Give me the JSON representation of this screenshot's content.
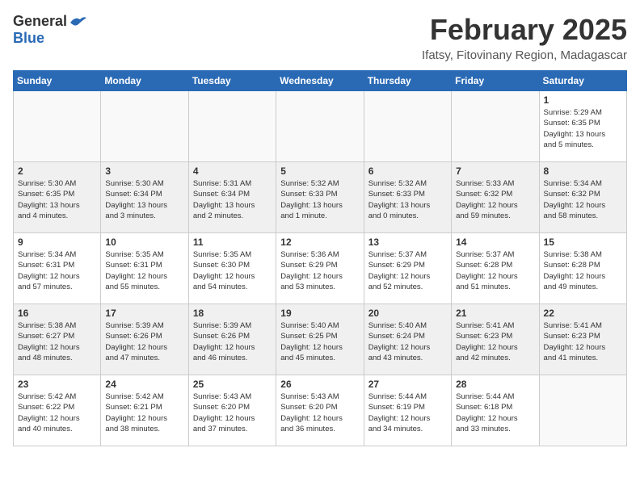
{
  "logo": {
    "general": "General",
    "blue": "Blue"
  },
  "title": "February 2025",
  "location": "Ifatsy, Fitovinany Region, Madagascar",
  "days_of_week": [
    "Sunday",
    "Monday",
    "Tuesday",
    "Wednesday",
    "Thursday",
    "Friday",
    "Saturday"
  ],
  "weeks": [
    [
      {
        "day": "",
        "info": ""
      },
      {
        "day": "",
        "info": ""
      },
      {
        "day": "",
        "info": ""
      },
      {
        "day": "",
        "info": ""
      },
      {
        "day": "",
        "info": ""
      },
      {
        "day": "",
        "info": ""
      },
      {
        "day": "1",
        "info": "Sunrise: 5:29 AM\nSunset: 6:35 PM\nDaylight: 13 hours\nand 5 minutes."
      }
    ],
    [
      {
        "day": "2",
        "info": "Sunrise: 5:30 AM\nSunset: 6:35 PM\nDaylight: 13 hours\nand 4 minutes."
      },
      {
        "day": "3",
        "info": "Sunrise: 5:30 AM\nSunset: 6:34 PM\nDaylight: 13 hours\nand 3 minutes."
      },
      {
        "day": "4",
        "info": "Sunrise: 5:31 AM\nSunset: 6:34 PM\nDaylight: 13 hours\nand 2 minutes."
      },
      {
        "day": "5",
        "info": "Sunrise: 5:32 AM\nSunset: 6:33 PM\nDaylight: 13 hours\nand 1 minute."
      },
      {
        "day": "6",
        "info": "Sunrise: 5:32 AM\nSunset: 6:33 PM\nDaylight: 13 hours\nand 0 minutes."
      },
      {
        "day": "7",
        "info": "Sunrise: 5:33 AM\nSunset: 6:32 PM\nDaylight: 12 hours\nand 59 minutes."
      },
      {
        "day": "8",
        "info": "Sunrise: 5:34 AM\nSunset: 6:32 PM\nDaylight: 12 hours\nand 58 minutes."
      }
    ],
    [
      {
        "day": "9",
        "info": "Sunrise: 5:34 AM\nSunset: 6:31 PM\nDaylight: 12 hours\nand 57 minutes."
      },
      {
        "day": "10",
        "info": "Sunrise: 5:35 AM\nSunset: 6:31 PM\nDaylight: 12 hours\nand 55 minutes."
      },
      {
        "day": "11",
        "info": "Sunrise: 5:35 AM\nSunset: 6:30 PM\nDaylight: 12 hours\nand 54 minutes."
      },
      {
        "day": "12",
        "info": "Sunrise: 5:36 AM\nSunset: 6:29 PM\nDaylight: 12 hours\nand 53 minutes."
      },
      {
        "day": "13",
        "info": "Sunrise: 5:37 AM\nSunset: 6:29 PM\nDaylight: 12 hours\nand 52 minutes."
      },
      {
        "day": "14",
        "info": "Sunrise: 5:37 AM\nSunset: 6:28 PM\nDaylight: 12 hours\nand 51 minutes."
      },
      {
        "day": "15",
        "info": "Sunrise: 5:38 AM\nSunset: 6:28 PM\nDaylight: 12 hours\nand 49 minutes."
      }
    ],
    [
      {
        "day": "16",
        "info": "Sunrise: 5:38 AM\nSunset: 6:27 PM\nDaylight: 12 hours\nand 48 minutes."
      },
      {
        "day": "17",
        "info": "Sunrise: 5:39 AM\nSunset: 6:26 PM\nDaylight: 12 hours\nand 47 minutes."
      },
      {
        "day": "18",
        "info": "Sunrise: 5:39 AM\nSunset: 6:26 PM\nDaylight: 12 hours\nand 46 minutes."
      },
      {
        "day": "19",
        "info": "Sunrise: 5:40 AM\nSunset: 6:25 PM\nDaylight: 12 hours\nand 45 minutes."
      },
      {
        "day": "20",
        "info": "Sunrise: 5:40 AM\nSunset: 6:24 PM\nDaylight: 12 hours\nand 43 minutes."
      },
      {
        "day": "21",
        "info": "Sunrise: 5:41 AM\nSunset: 6:23 PM\nDaylight: 12 hours\nand 42 minutes."
      },
      {
        "day": "22",
        "info": "Sunrise: 5:41 AM\nSunset: 6:23 PM\nDaylight: 12 hours\nand 41 minutes."
      }
    ],
    [
      {
        "day": "23",
        "info": "Sunrise: 5:42 AM\nSunset: 6:22 PM\nDaylight: 12 hours\nand 40 minutes."
      },
      {
        "day": "24",
        "info": "Sunrise: 5:42 AM\nSunset: 6:21 PM\nDaylight: 12 hours\nand 38 minutes."
      },
      {
        "day": "25",
        "info": "Sunrise: 5:43 AM\nSunset: 6:20 PM\nDaylight: 12 hours\nand 37 minutes."
      },
      {
        "day": "26",
        "info": "Sunrise: 5:43 AM\nSunset: 6:20 PM\nDaylight: 12 hours\nand 36 minutes."
      },
      {
        "day": "27",
        "info": "Sunrise: 5:44 AM\nSunset: 6:19 PM\nDaylight: 12 hours\nand 34 minutes."
      },
      {
        "day": "28",
        "info": "Sunrise: 5:44 AM\nSunset: 6:18 PM\nDaylight: 12 hours\nand 33 minutes."
      },
      {
        "day": "",
        "info": ""
      }
    ]
  ]
}
